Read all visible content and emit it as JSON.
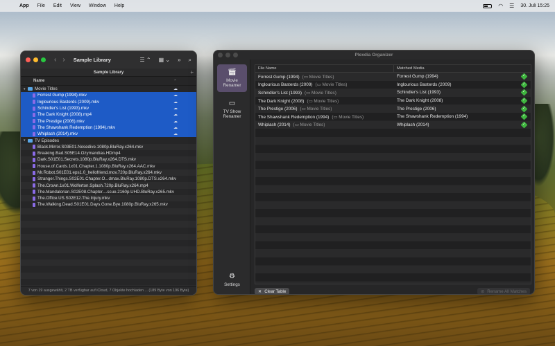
{
  "menubar": {
    "app": "App",
    "menus": [
      "File",
      "Edit",
      "View",
      "Window",
      "Help"
    ],
    "clock": "30. Juli  15:25"
  },
  "finder": {
    "title": "Sample Library",
    "tab": "Sample Library",
    "column_name": "Name",
    "groups": [
      {
        "name": "Movie Titles",
        "files": [
          "Forrest Gump (1994).mkv",
          "Inglourious Basterds (2009).mkv",
          "Schindler's List (1993).mkv",
          "The Dark Knight (2008).mp4",
          "The Prestige (2006).mkv",
          "The Shawshank Redemption (1994).mkv",
          "Whiplash (2014).mkv"
        ]
      },
      {
        "name": "TV Episodes",
        "files": [
          "Black.Mirror.S03E01.Nosedive.1080p.BluRay.x264.mkv",
          "Breaking.Bad.S05E14.Ozymandias.HDmp4",
          "Dark.S01E01.Secrets.1080p.BluRay.x264.DTS.mkv",
          "House.of.Cards.1x01.Chapter.1.1080p.BluRay.x264.AAC.mkv",
          "Mr.Robot.S01E01.eps1.0_hellofriend.mov.720p.BluRay.x264.mkv",
          "Stranger.Things.S02E01.Chapter.O...dmax.BluRay.1080p.DTS.x264.mkv",
          "The.Crown.1x01.Wolferton.Splash.720p.BluRay.x264.mp4",
          "The.Mandalorian.S02E08.Chapter....scue.2160p.UHD.BluRay.x265.mkv",
          "The.Office.US.S02E12.The.Injury.mkv",
          "The.Walking.Dead.S01E01.Days.Gone.Bye.1080p.BluRay.x265.mkv"
        ]
      }
    ],
    "footer": "7 von 19 ausgewählt, 2 TB verfügbar auf iCloud, 7 Objekte hochladen ... (189 Byte von 196 Byte)"
  },
  "plex": {
    "window_title": "Plexdia Organizer",
    "sidebar": [
      {
        "label": "Movie\nRenamer",
        "icon": "clapperboard-icon",
        "active": true
      },
      {
        "label": "TV Show\nRenamer",
        "icon": "tv-icon",
        "active": false
      },
      {
        "label": "Settings",
        "icon": "gear-icon",
        "active": false
      }
    ],
    "table": {
      "col_file": "File Name",
      "col_match": "Matched Media",
      "rows": [
        {
          "file": "Forrest Gump (1994)",
          "tag": "Movie Titles",
          "match": "Forrest Gump (1994)"
        },
        {
          "file": "Inglourious Basterds (2009)",
          "tag": "Movie Titles",
          "match": "Inglourious Basterds (2009)"
        },
        {
          "file": "Schindler's List (1993)",
          "tag": "Movie Titles",
          "match": "Schindler's List (1993)"
        },
        {
          "file": "The Dark Knight (2008)",
          "tag": "Movie Titles",
          "match": "The Dark Knight (2008)"
        },
        {
          "file": "The Prestige (2006)",
          "tag": "Movie Titles",
          "match": "The Prestige (2006)"
        },
        {
          "file": "The Shawshank Redemption (1994)",
          "tag": "Movie Titles",
          "match": "The Shawshank Redemption (1994)"
        },
        {
          "file": "Whiplash (2014)",
          "tag": "Movie Titles",
          "match": "Whiplash (2014)"
        }
      ]
    },
    "clear_button": "Clear Table",
    "rename_button": "Rename All Matches",
    "colors": {
      "accent": "#5a4e6c",
      "selection": "#1e5bc6",
      "check": "#3fb53f"
    }
  }
}
